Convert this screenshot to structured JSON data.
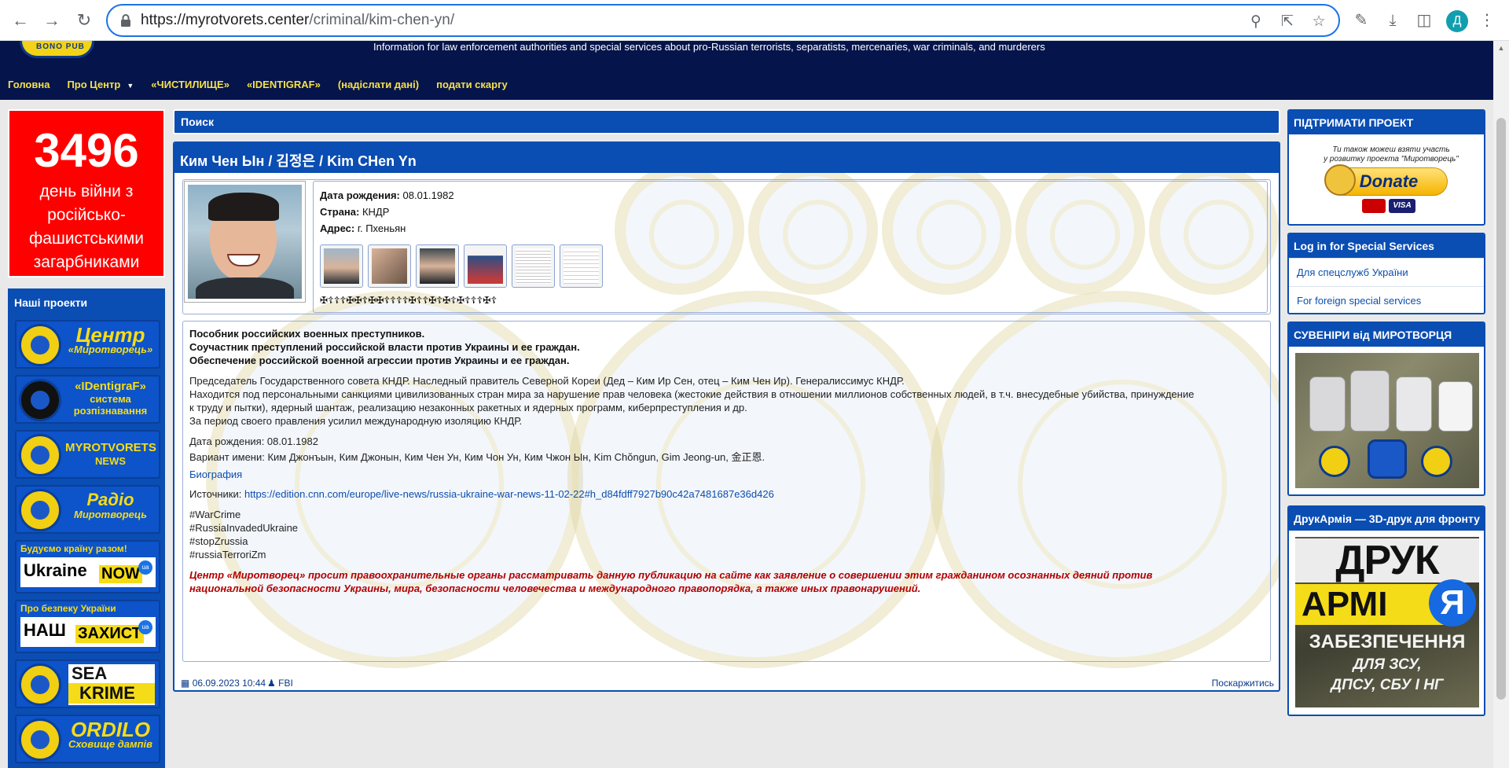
{
  "browser": {
    "url_host": "https://myrotvorets.center",
    "url_path": "/criminal/kim-chen-yn/",
    "profile_initial": "Д"
  },
  "header": {
    "logo_text": "BONO PUB",
    "subtitle": "Information for law enforcement authorities and special services about pro-Russian terrorists, separatists, mercenaries, war criminals, and murderers",
    "nav": [
      "Головна",
      "Про Центр",
      "«ЧИСТИЛИЩЕ»",
      "«IDENTIGRAF»",
      "(надіслати дані)",
      "подати скаргу"
    ]
  },
  "war_counter": {
    "days": "3496",
    "line1": "день війни з",
    "line2": "російсько-",
    "line3": "фашистськими",
    "line4": "загарбниками"
  },
  "projects": {
    "title": "Наші проекти",
    "items": [
      {
        "big": "Центр",
        "small": "«Миротворець»"
      },
      {
        "big": "«IDentigraF»",
        "small": "система розпізнавання"
      },
      {
        "big": "MYROTVORETS",
        "small": "NEWS"
      },
      {
        "big": "Радіо",
        "small": "Миротворець"
      }
    ],
    "ukraine_now": {
      "head": "Будуємо країну разом!",
      "w1": "Ukraine",
      "w2": "NOW",
      "badge": "ua"
    },
    "nash_zakhyst": {
      "head": "Про безпеку України",
      "w1": "НАШ",
      "w2": "ЗАХИСТ",
      "badge": "ua"
    },
    "sea_krime": {
      "w1": "SEA",
      "w2": "KRIME"
    },
    "ordilo": {
      "big": "ORDILO",
      "small": "Сховище дампів"
    }
  },
  "search": {
    "label": "Поиск"
  },
  "article": {
    "title": "Ким Чен Ын / 김정은 / Kim CHen Yn",
    "birth_label": "Дата рождения:",
    "birth_value": "08.01.1982",
    "country_label": "Страна:",
    "country_value": "КНДР",
    "address_label": "Адрес:",
    "address_value": "г. Пхеньян",
    "crosses": "✠☦☦☦✠✠☦✠✠☦☦☦☦✠☦☦✠☦✠☦✠☦☦☦✠☦",
    "bold_lines": [
      "Пособник российских военных преступников.",
      "Соучастник преступлений российской власти против Украины и ее граждан.",
      "Обеспечение российской военной агрессии против Украины и ее граждан."
    ],
    "para1": [
      "Председатель Государственного совета КНДР. Наследный правитель Северной Кореи (Дед – Ким Ир Сен, отец – Ким Чен Ир). Генералиссимус КНДР.",
      "Находится под персональными санкциями цивилизованных стран мира за нарушение прав человека (жестокие действия в отношении миллионов собственных людей, в т.ч. внесудебные убийства, принуждение",
      "к труду и пытки), ядерный шантаж, реализацию незаконных ракетных и ядерных программ, киберпреступления и др.",
      "За период своего правления усилил международную изоляцию КНДР."
    ],
    "para2": [
      "Дата рождения: 08.01.1982",
      "Вариант имени: Ким Джонъын, Ким Джонын, Ким Чен Ун, Ким Чон Ун, Ким Чжон Ын, Kim Chŏngun, Gim Jeong-un, 金正恩."
    ],
    "bio_link": "Биография",
    "sources_label": "Источники:",
    "sources_url": "https://edition.cnn.com/europe/live-news/russia-ukraine-war-news-11-02-22#h_d84fdff7927b90c42a7481687e36d426",
    "hashtags": [
      "#WarCrime",
      "#RussiaInvadedUkraine",
      "#stopZrussia",
      "#russiaTerroriZm"
    ],
    "warning": [
      "Центр «Миротворец» просит правоохранительные органы рассматривать данную публикацию на сайте как заявление о совершении этим гражданином осознанных деяний против",
      "национальной безопасности Украины, мира, безопасности человечества и международного правопорядка, а также иных правонарушений."
    ],
    "date": "06.09.2023 10:44",
    "author": "FBI",
    "complain": "Поскаржитись"
  },
  "right": {
    "support_title": "ПІДТРИМАТИ ПРОЕКТ",
    "donate_note1": "Ти також можеш взяти участь",
    "donate_note2": "у розвитку проекта \"Миротворець\"",
    "donate_label": "Donate",
    "visa": "VISA",
    "login_title": "Log in for Special Services",
    "login_links": [
      "Для спецслужб України",
      "For foreign special services"
    ],
    "souvenir_title": "СУВЕНІРИ від МИРОТВОРЦЯ",
    "druk_title": "ДрукАрмія — 3D-друк для фронту",
    "druk_l1": "ДРУК",
    "druk_l2": "АРМІ",
    "druk_ya": "Я",
    "druk_l3": "ЗАБЕЗПЕЧЕННЯ",
    "druk_l4a": "ДЛЯ ЗСУ,",
    "druk_l4b": "ДПСУ, СБУ І НГ"
  }
}
